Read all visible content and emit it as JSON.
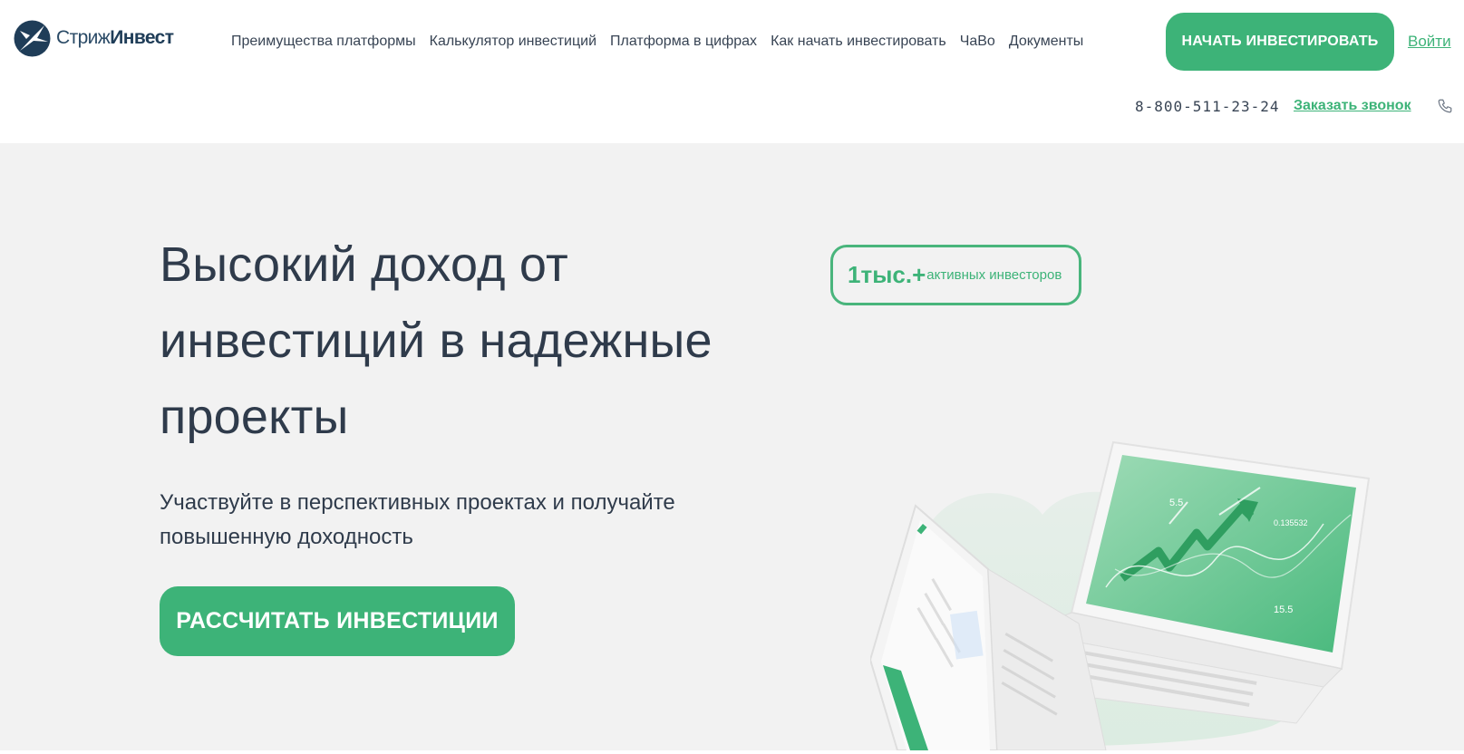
{
  "brand": {
    "name_part1": "Стриж",
    "name_part2": "Инвест",
    "accent_color": "#3db378",
    "logo_color": "#1f3d58"
  },
  "nav": {
    "items": [
      {
        "label": "Преимущества платформы"
      },
      {
        "label": "Калькулятор инвестиций"
      },
      {
        "label": "Платформа в цифрах"
      },
      {
        "label": "Как начать инвестировать"
      },
      {
        "label": "ЧаВо"
      },
      {
        "label": "Документы"
      }
    ],
    "cta_label": "НАЧАТЬ ИНВЕСТИРОВАТЬ",
    "login_label": "Войти"
  },
  "contact": {
    "phone": "8-800-511-23-24",
    "callback_label": "Заказать звонок",
    "phone_icon": "phone-icon"
  },
  "hero": {
    "title": "Высокий доход от инвестиций в надежные проекты",
    "subtitle": "Участвуйте в перспективных проектах и получайте повышенную доходность",
    "cta_label": "РАССЧИТАТЬ ИНВЕСТИЦИИ"
  },
  "stat": {
    "value": "1тыс.",
    "plus": "+",
    "label": "активных инвесторов"
  },
  "illustration": {
    "screen_labels": [
      "5.5",
      "0.135532",
      "15.5"
    ]
  }
}
